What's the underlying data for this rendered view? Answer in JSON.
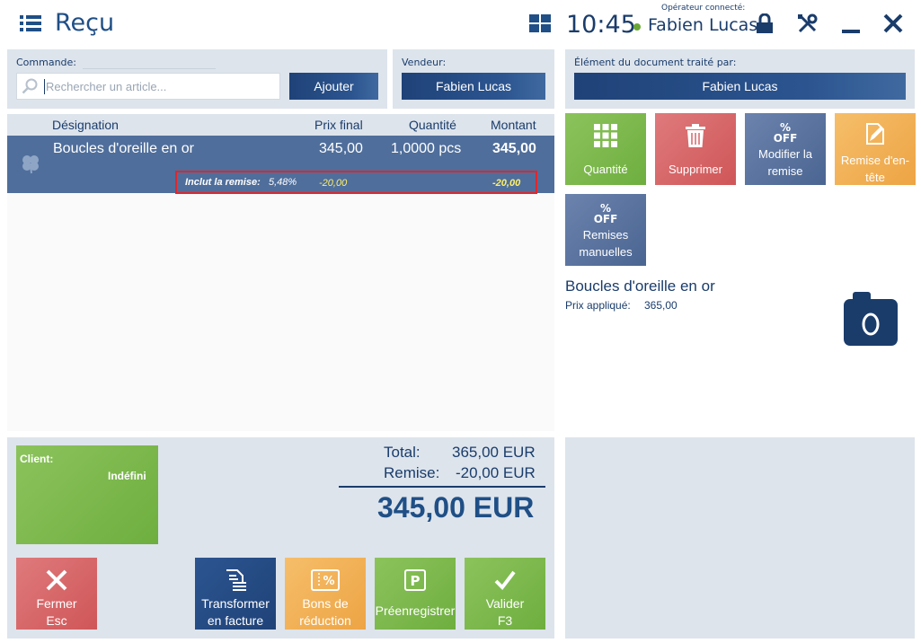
{
  "header": {
    "title": "Reçu",
    "clock": "10:45",
    "operator_caption": "Opérateur connecté:",
    "operator_name": "Fabien Lucas",
    "icons": [
      "menu-icon",
      "layout-icon",
      "lock-icon",
      "tools-icon",
      "minimize-icon",
      "close-icon"
    ]
  },
  "order": {
    "caption": "Commande:",
    "search_placeholder": "Rechercher un article...",
    "search_value": "",
    "add_label": "Ajouter"
  },
  "seller": {
    "caption": "Vendeur:",
    "name": "Fabien Lucas"
  },
  "processed_by": {
    "caption": "Élément du document traité par:",
    "name": "Fabien Lucas"
  },
  "table": {
    "columns": [
      "Désignation",
      "Prix final",
      "Quantité",
      "Montant"
    ],
    "rows": [
      {
        "name": "Boucles d'oreille en or",
        "price": "345,00",
        "quantity": "1,0000 pcs",
        "amount": "345,00",
        "discount_label": "Inclut la remise:",
        "discount_percent": "5,48%",
        "discount_value": "-20,00",
        "discount_total": "-20,00"
      }
    ]
  },
  "actions": {
    "quantity": "Quantité",
    "delete": "Supprimer",
    "edit_discount_line1": "Modifier la",
    "edit_discount_line2": "remise",
    "header_discount_line1": "Remise d'en-",
    "header_discount_line2": "tête",
    "manual_discounts_line1": "Remises",
    "manual_discounts_line2": "manuelles",
    "off_top": "%",
    "off_bottom": "OFF"
  },
  "detail": {
    "name": "Boucles d'oreille en or",
    "price_label": "Prix appliqué:",
    "price_value": "365,00"
  },
  "client": {
    "label": "Client:",
    "value": "Indéfini"
  },
  "summary": {
    "total_label": "Total:",
    "total_value": "365,00 EUR",
    "discount_label": "Remise:",
    "discount_value": "-20,00 EUR",
    "grand_total": "345,00 EUR"
  },
  "buttons": {
    "close_line1": "Fermer",
    "close_line2": "Esc",
    "invoice_line1": "Transformer",
    "invoice_line2": "en facture",
    "vouchers_line1": "Bons de",
    "vouchers_line2": "réduction",
    "preregister": "Préenregistrer",
    "validate_line1": "Valider",
    "validate_line2": "F3"
  },
  "colors": {
    "primary": "#1f4278",
    "row_selected": "#4f6e9b",
    "green": "#6eae3f",
    "red": "#cf5658",
    "orange": "#eda444",
    "panel": "#dde4ec",
    "highlight": "#e0262c",
    "discount_text": "#ffef6a"
  }
}
